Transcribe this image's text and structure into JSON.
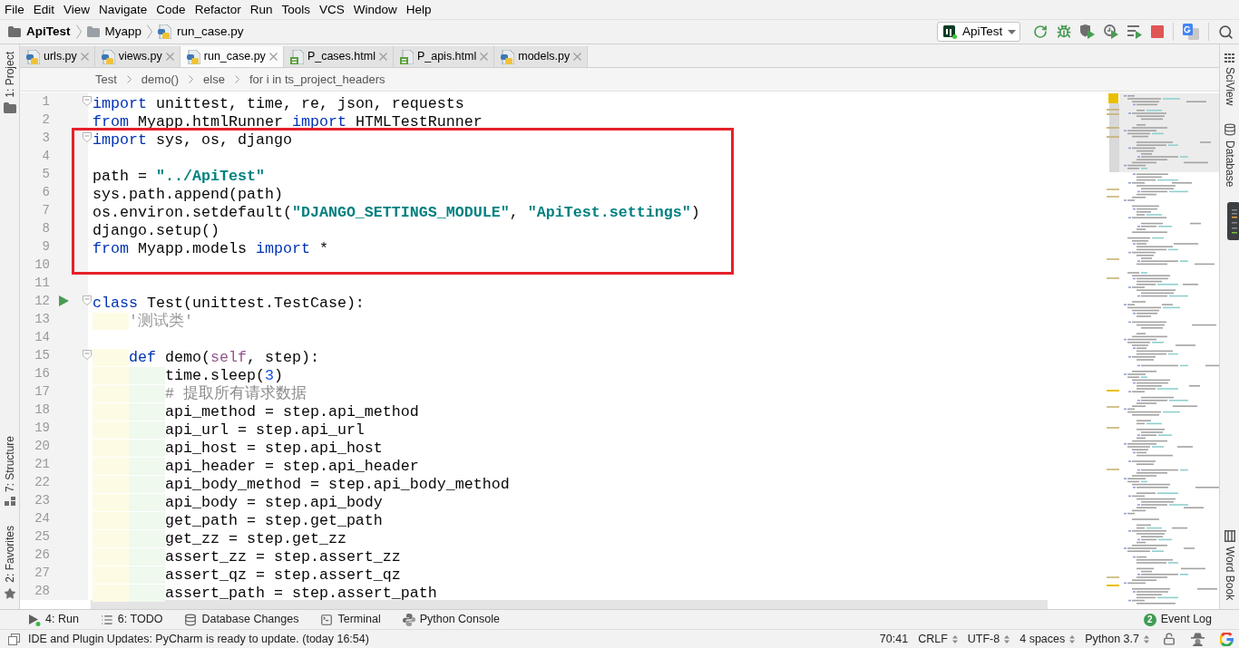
{
  "menu": [
    "File",
    "Edit",
    "View",
    "Navigate",
    "Code",
    "Refactor",
    "Run",
    "Tools",
    "VCS",
    "Window",
    "Help"
  ],
  "navigation_bar": {
    "path": [
      {
        "kind": "project",
        "label": "ApiTest"
      },
      {
        "kind": "folder",
        "label": "Myapp"
      },
      {
        "kind": "file",
        "label": "run_case.py"
      }
    ],
    "run_configuration": "ApiTest"
  },
  "left_tool_strip": {
    "top": [
      {
        "kind": "project",
        "label": "1: Project"
      }
    ],
    "bottom": [
      {
        "kind": "structure",
        "label": "7: Structure"
      },
      {
        "kind": "favorites",
        "label": "2: Favorites"
      }
    ]
  },
  "right_tool_strip": {
    "top": [
      {
        "kind": "sciview",
        "label": "SciView"
      },
      {
        "kind": "database",
        "label": "Database"
      }
    ],
    "bottom": [
      {
        "kind": "book",
        "label": "Word Book"
      }
    ]
  },
  "tabs": [
    {
      "label": "urls.py",
      "kind": "python",
      "selected": false
    },
    {
      "label": "views.py",
      "kind": "python",
      "selected": false
    },
    {
      "label": "run_case.py",
      "kind": "python",
      "selected": true
    },
    {
      "label": "P_cases.html",
      "kind": "html",
      "selected": false
    },
    {
      "label": "P_apis.html",
      "kind": "html",
      "selected": false
    },
    {
      "label": "models.py",
      "kind": "python",
      "selected": false
    }
  ],
  "editor_breadcrumbs": [
    "Test",
    "demo()",
    "else",
    "for i in ts_project_headers"
  ],
  "code_blocks": [
    {
      "boxed": false,
      "lines": [
        {
          "number": "1",
          "fold": true,
          "run": false,
          "tokens": [
            {
              "kind": "keyword",
              "text": "import"
            },
            {
              "kind": "plain",
              "text": " unittest, time, re, json, requests"
            }
          ]
        },
        {
          "number": "2",
          "fold": false,
          "run": false,
          "tokens": [
            {
              "kind": "keyword",
              "text": "from"
            },
            {
              "kind": "plain",
              "text": " Myapp.htmlRunner "
            },
            {
              "kind": "keyword",
              "text": "import"
            },
            {
              "kind": "plain",
              "text": " HTMLTestRunner"
            }
          ]
        }
      ]
    },
    {
      "boxed": true,
      "lines": [
        {
          "number": "3",
          "fold": true,
          "run": false,
          "tokens": [
            {
              "kind": "keyword",
              "text": "import"
            },
            {
              "kind": "plain",
              "text": " sys, os, django"
            }
          ]
        },
        {
          "number": "4",
          "fold": false,
          "run": false
        },
        {
          "number": "5",
          "fold": false,
          "run": false,
          "tokens": [
            {
              "kind": "plain",
              "text": "path = "
            },
            {
              "kind": "string",
              "text": "\"../ApiTest\""
            }
          ]
        },
        {
          "number": "6",
          "fold": false,
          "run": false,
          "tokens": [
            {
              "kind": "plain",
              "text": "sys.path.append(path)"
            }
          ]
        },
        {
          "number": "7",
          "fold": false,
          "run": false,
          "tokens": [
            {
              "kind": "plain",
              "text": "os.environ.setdefault("
            },
            {
              "kind": "string",
              "text": "\"DJANGO_SETTINGS_MODULE\""
            },
            {
              "kind": "plain",
              "text": ", "
            },
            {
              "kind": "string",
              "text": "\"ApiTest.settings\""
            },
            {
              "kind": "plain",
              "text": ")"
            }
          ]
        },
        {
          "number": "8",
          "fold": false,
          "run": false,
          "tokens": [
            {
              "kind": "plain",
              "text": "django.setup()"
            }
          ]
        },
        {
          "number": "9",
          "fold": false,
          "run": false,
          "tokens": [
            {
              "kind": "keyword",
              "text": "from"
            },
            {
              "kind": "plain",
              "text": " Myapp.models "
            },
            {
              "kind": "keyword",
              "text": "import"
            },
            {
              "kind": "plain",
              "text": " *"
            }
          ]
        },
        {
          "number": "10",
          "fold": false,
          "run": false
        }
      ]
    },
    {
      "boxed": false,
      "lines": [
        {
          "number": "11",
          "fold": false,
          "run": false
        },
        {
          "number": "12",
          "fold": true,
          "run": true,
          "tokens": [
            {
              "kind": "keyword",
              "text": "class"
            },
            {
              "kind": "plain",
              "text": " Test(unittest.TestCase):"
            }
          ]
        },
        {
          "number": "13",
          "fold": false,
          "run": false,
          "tokens": [
            {
              "kind": "docstring",
              "text": "    '测试类'"
            }
          ]
        },
        {
          "number": "14",
          "fold": false,
          "run": false
        },
        {
          "number": "15",
          "fold": true,
          "run": false,
          "tokens": [
            {
              "kind": "keyword",
              "text": "    def"
            },
            {
              "kind": "plain",
              "text": " demo("
            },
            {
              "kind": "self",
              "text": "self"
            },
            {
              "kind": "plain",
              "text": ", step):"
            }
          ]
        },
        {
          "number": "16",
          "fold": false,
          "run": false,
          "tokens": [
            {
              "kind": "plain",
              "text": "        time.sleep("
            },
            {
              "kind": "number",
              "text": "3"
            },
            {
              "kind": "plain",
              "text": ")"
            }
          ]
        },
        {
          "number": "17",
          "fold": false,
          "run": false,
          "tokens": [
            {
              "kind": "comment",
              "text": "        # 提取所有请求数据"
            }
          ]
        },
        {
          "number": "18",
          "fold": false,
          "run": false,
          "tokens": [
            {
              "kind": "plain",
              "text": "        api_method = step.api_method"
            }
          ]
        },
        {
          "number": "19",
          "fold": false,
          "run": false,
          "tokens": [
            {
              "kind": "plain",
              "text": "        api_url = step.api_url"
            }
          ]
        },
        {
          "number": "20",
          "fold": false,
          "run": false,
          "tokens": [
            {
              "kind": "plain",
              "text": "        api_host = step.api_host"
            }
          ]
        },
        {
          "number": "21",
          "fold": false,
          "run": false,
          "tokens": [
            {
              "kind": "plain",
              "text": "        api_header = step.api_header"
            }
          ]
        },
        {
          "number": "22",
          "fold": false,
          "run": false,
          "tokens": [
            {
              "kind": "plain",
              "text": "        api_body_method = step.api_body_method"
            }
          ]
        },
        {
          "number": "23",
          "fold": false,
          "run": false,
          "tokens": [
            {
              "kind": "plain",
              "text": "        api_body = step.api_body"
            }
          ]
        },
        {
          "number": "24",
          "fold": false,
          "run": false,
          "tokens": [
            {
              "kind": "plain",
              "text": "        get_path = step.get_path"
            }
          ]
        },
        {
          "number": "25",
          "fold": false,
          "run": false,
          "tokens": [
            {
              "kind": "plain",
              "text": "        get_zz = step.get_zz"
            }
          ]
        },
        {
          "number": "26",
          "fold": false,
          "run": false,
          "tokens": [
            {
              "kind": "plain",
              "text": "        assert_zz = step.assert_zz"
            }
          ]
        },
        {
          "number": "27",
          "fold": false,
          "run": false,
          "tokens": [
            {
              "kind": "plain",
              "text": "        assert_qz = step.assert_qz"
            }
          ]
        },
        {
          "number": "28",
          "fold": false,
          "run": false,
          "tokens": [
            {
              "kind": "plain",
              "text": "        assert_path = step.assert_path"
            }
          ]
        }
      ]
    }
  ],
  "tool_windows": [
    {
      "kind": "run",
      "label": "4: Run"
    },
    {
      "kind": "todo",
      "label": "6: TODO"
    },
    {
      "kind": "database",
      "label": "Database Changes"
    },
    {
      "kind": "terminal",
      "label": "Terminal"
    },
    {
      "kind": "python",
      "label": "Python Console"
    }
  ],
  "event_log": {
    "label": "Event Log",
    "count": "2"
  },
  "status_bar": {
    "message": "IDE and Plugin Updates: PyCharm is ready to update. (today 16:54)",
    "items": [
      {
        "kind": "position",
        "label": "70:41"
      },
      {
        "kind": "selector",
        "label": "CRLF"
      },
      {
        "kind": "selector",
        "label": "UTF-8"
      },
      {
        "kind": "selector",
        "label": "4 spaces"
      },
      {
        "kind": "selector",
        "label": "Python 3.7"
      }
    ]
  }
}
